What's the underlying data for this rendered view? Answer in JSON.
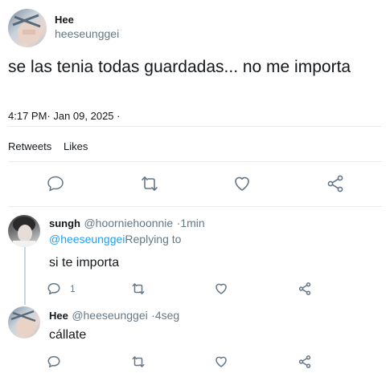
{
  "main_tweet": {
    "author_name": "Hee",
    "author_handle": "heeseunggei",
    "text": "se las tenia todas guardadas... no me importa",
    "timestamp": "4:17 PM· Jan 09, 2025 ·"
  },
  "stats": {
    "retweets_label": "Retweets",
    "likes_label": "Likes"
  },
  "replies": [
    {
      "author_name": "sungh",
      "author_handle": "@hoorniehoonnie",
      "time": "·1min",
      "replying_handle": "@heeseunggei",
      "replying_label": "Replying to",
      "text": "si te importa",
      "reply_count": "1"
    },
    {
      "author_name": "Hee",
      "author_handle": "@heeseunggei",
      "time": "·4seg",
      "text": "cállate"
    }
  ],
  "colors": {
    "link": "#1da1f2",
    "muted": "#657786",
    "divider": "#e6ecf0",
    "thread_line": "#ccd6dd"
  },
  "icons": [
    "reply-icon",
    "retweet-icon",
    "like-icon",
    "share-icon"
  ]
}
